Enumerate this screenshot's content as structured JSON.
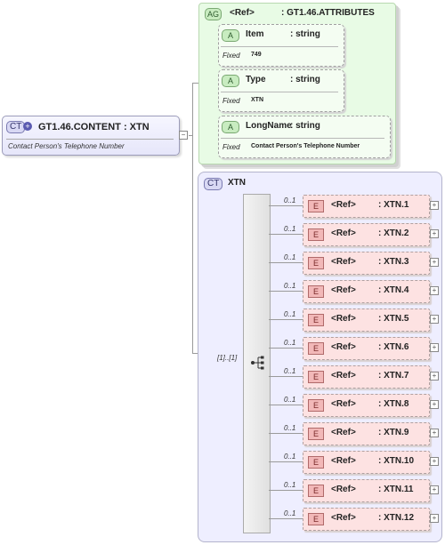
{
  "root": {
    "badge": "CT",
    "title": "GT1.46.CONTENT : XTN",
    "description": "Contact Person's Telephone Number"
  },
  "attribute_group": {
    "badge": "AG",
    "ref": "<Ref>",
    "name": ": GT1.46.ATTRIBUTES",
    "attributes": [
      {
        "badge": "A",
        "name": "Item",
        "type": ": string",
        "fixed_label": "Fixed",
        "fixed_value": "749"
      },
      {
        "badge": "A",
        "name": "Type",
        "type": ": string",
        "fixed_label": "Fixed",
        "fixed_value": "XTN"
      },
      {
        "badge": "A",
        "name": "LongName",
        "type": ": string",
        "fixed_label": "Fixed",
        "fixed_value": "Contact Person's Telephone Number"
      }
    ]
  },
  "complex_type": {
    "badge": "CT",
    "name": "XTN",
    "sequence_occurrence": "[1]..[1]",
    "sequence_icon": "sequence-compositor-icon",
    "elements": [
      {
        "badge": "E",
        "ref": "<Ref>",
        "name": ": XTN.1",
        "occurrence": "0..1"
      },
      {
        "badge": "E",
        "ref": "<Ref>",
        "name": ": XTN.2",
        "occurrence": "0..1"
      },
      {
        "badge": "E",
        "ref": "<Ref>",
        "name": ": XTN.3",
        "occurrence": "0..1"
      },
      {
        "badge": "E",
        "ref": "<Ref>",
        "name": ": XTN.4",
        "occurrence": "0..1"
      },
      {
        "badge": "E",
        "ref": "<Ref>",
        "name": ": XTN.5",
        "occurrence": "0..1"
      },
      {
        "badge": "E",
        "ref": "<Ref>",
        "name": ": XTN.6",
        "occurrence": "0..1"
      },
      {
        "badge": "E",
        "ref": "<Ref>",
        "name": ": XTN.7",
        "occurrence": "0..1"
      },
      {
        "badge": "E",
        "ref": "<Ref>",
        "name": ": XTN.8",
        "occurrence": "0..1"
      },
      {
        "badge": "E",
        "ref": "<Ref>",
        "name": ": XTN.9",
        "occurrence": "0..1"
      },
      {
        "badge": "E",
        "ref": "<Ref>",
        "name": ": XTN.10",
        "occurrence": "0..1"
      },
      {
        "badge": "E",
        "ref": "<Ref>",
        "name": ": XTN.11",
        "occurrence": "0..1"
      },
      {
        "badge": "E",
        "ref": "<Ref>",
        "name": ": XTN.12",
        "occurrence": "0..1"
      }
    ]
  }
}
